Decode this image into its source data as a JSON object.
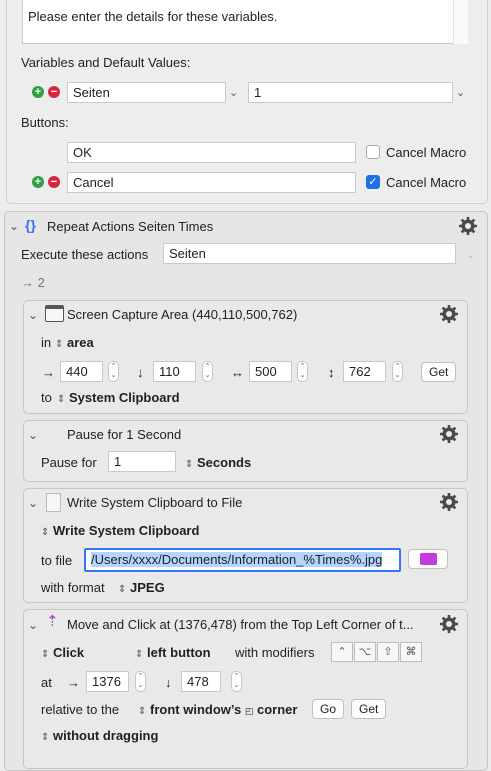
{
  "prompt": {
    "text": "Please enter the details for these variables.",
    "variables_label": "Variables and Default Values:",
    "variable_name": "Seiten",
    "variable_default": "1",
    "buttons_label": "Buttons:",
    "buttons": [
      {
        "name": "OK",
        "cancel_label": "Cancel Macro",
        "checked": false
      },
      {
        "name": "Cancel",
        "cancel_label": "Cancel Macro",
        "checked": true
      }
    ]
  },
  "repeat": {
    "title": "Repeat Actions Seiten Times",
    "execute_label": "Execute these actions",
    "execute_value": "Seiten",
    "arrow_text": "→ 2"
  },
  "capture": {
    "title": "Screen Capture Area (440,110,500,762)",
    "in_label": "in",
    "area_value": "area",
    "x_arrow": "→",
    "x": "440",
    "y_arrow": "↓",
    "y": "110",
    "w_arrow": "↔",
    "w": "500",
    "h_arrow": "↕",
    "h": "762",
    "get_label": "Get",
    "to_label": "to",
    "to_value": "System Clipboard"
  },
  "pause": {
    "title": "Pause for 1 Second",
    "label": "Pause for",
    "value": "1",
    "unit": "Seconds"
  },
  "write": {
    "title": "Write System Clipboard to File",
    "source": "Write System Clipboard",
    "file_label": "to file",
    "file_path": "/Users/xxxx/Documents/Information_%Times%.jpg",
    "format_label": "with format",
    "format_value": "JPEG"
  },
  "click": {
    "title": "Move and Click at (1376,478) from the Top Left Corner of t...",
    "action": "Click",
    "button": "left button",
    "modifiers_label": "with modifiers",
    "modifiers": [
      "⌃",
      "⌥",
      "⇧",
      "⌘"
    ],
    "at_label": "at",
    "x_arrow": "→",
    "x": "1376",
    "y_arrow": "↓",
    "y": "478",
    "relative_label": "relative to the",
    "relative_value": "front window’s",
    "corner_label": "corner",
    "go_label": "Go",
    "get_label": "Get",
    "drag_value": "without dragging"
  }
}
